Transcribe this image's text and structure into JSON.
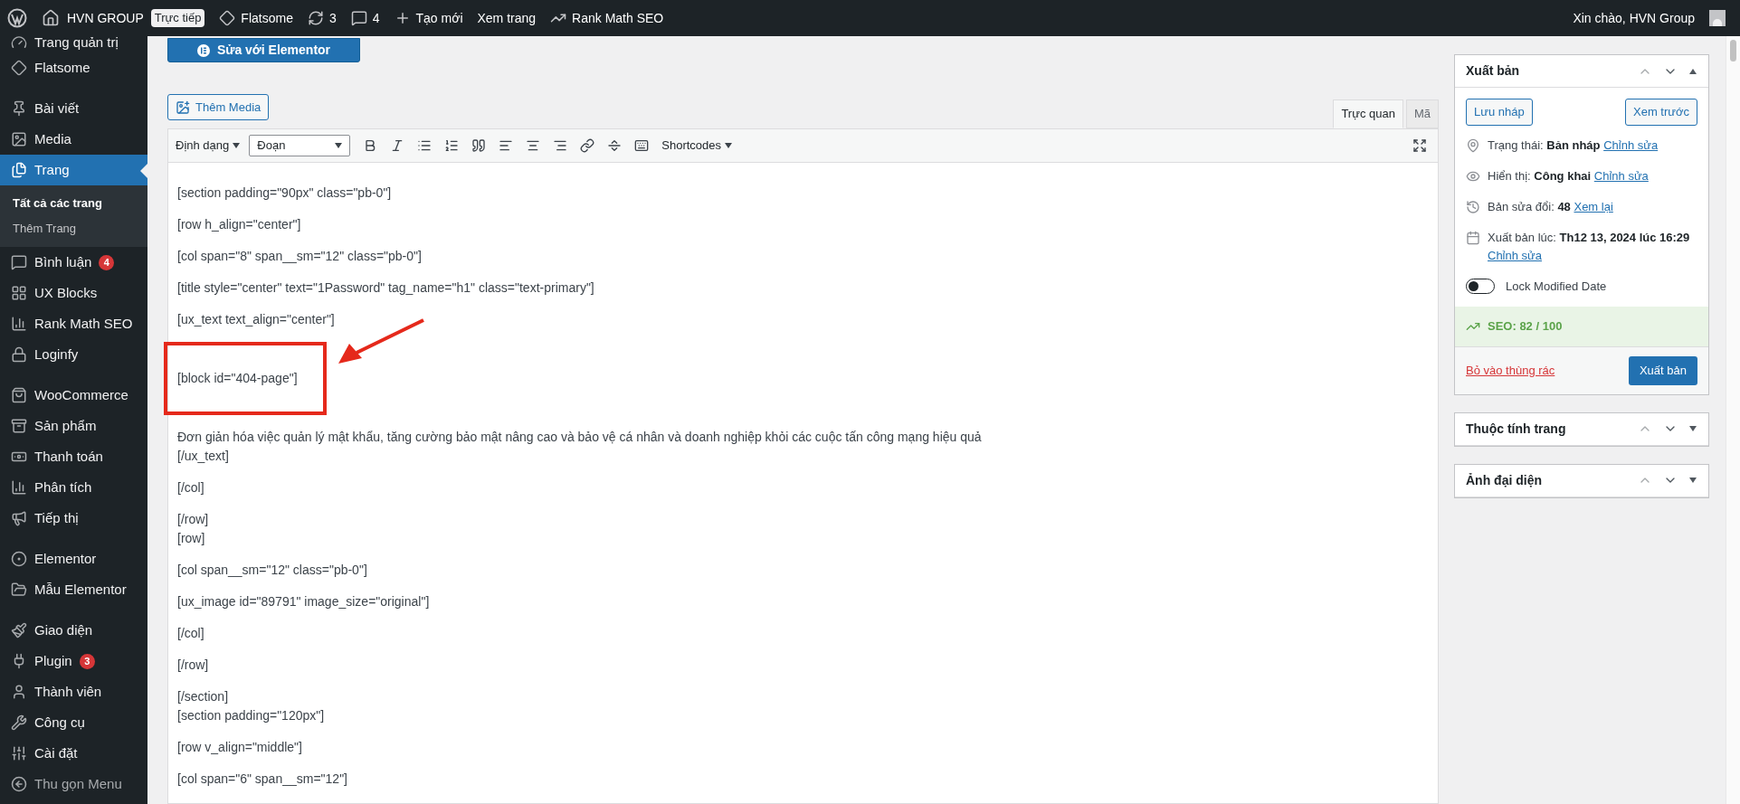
{
  "admin_bar": {
    "site": "HVN GROUP",
    "live_badge": "Trực tiếp",
    "items": [
      {
        "label": "Flatsome"
      },
      {
        "label": "3"
      },
      {
        "label": "4"
      },
      {
        "label": "Tạo mới"
      },
      {
        "label": "Xem trang"
      },
      {
        "label": "Rank Math SEO"
      }
    ],
    "greeting": "Xin chào, HVN Group"
  },
  "sidebar": {
    "groups": [
      {
        "items": [
          {
            "label": "Trang quản trị",
            "kind": "cut",
            "selected": false
          },
          {
            "label": "Flatsome",
            "selected": false
          }
        ]
      },
      {
        "items": [
          {
            "label": "Bài viết",
            "selected": false
          },
          {
            "label": "Media",
            "selected": false
          },
          {
            "label": "Trang",
            "selected": true,
            "children": [
              {
                "label": "Tất cả các trang",
                "selected": true
              },
              {
                "label": "Thêm Trang",
                "selected": false
              }
            ]
          },
          {
            "label": "Bình luận",
            "badge": "4",
            "selected": false
          },
          {
            "label": "UX Blocks",
            "selected": false
          },
          {
            "label": "Rank Math SEO",
            "selected": false
          },
          {
            "label": "Loginfy",
            "selected": false
          }
        ]
      },
      {
        "items": [
          {
            "label": "WooCommerce",
            "selected": false
          },
          {
            "label": "Sản phẩm",
            "selected": false
          },
          {
            "label": "Thanh toán",
            "selected": false
          },
          {
            "label": "Phân tích",
            "selected": false
          },
          {
            "label": "Tiếp thị",
            "selected": false
          }
        ]
      },
      {
        "items": [
          {
            "label": "Elementor",
            "selected": false
          },
          {
            "label": "Mẫu Elementor",
            "selected": false
          }
        ]
      },
      {
        "items": [
          {
            "label": "Giao diện",
            "selected": false
          },
          {
            "label": "Plugin",
            "badge": "3",
            "selected": false
          },
          {
            "label": "Thành viên",
            "selected": false
          },
          {
            "label": "Công cụ",
            "selected": false
          },
          {
            "label": "Cài đặt",
            "selected": false
          },
          {
            "label": "Thu gọn Menu",
            "kind": "collapse",
            "selected": false
          }
        ]
      }
    ]
  },
  "editor": {
    "elementor_button": "Sửa với Elementor",
    "media_button": "Thêm Media",
    "tabs": [
      {
        "label": "Trực quan",
        "selected": true
      },
      {
        "label": "Mã",
        "selected": false
      }
    ],
    "toolbar": {
      "format_menu": "Định dạng",
      "paragraph_select": "Đoạn",
      "shortcodes_menu": "Shortcodes"
    },
    "paragraphs": [
      {
        "lines": [
          "[section padding=\"90px\" class=\"pb-0\"]"
        ]
      },
      {
        "lines": [
          "[row h_align=\"center\"]"
        ]
      },
      {
        "lines": [
          "[col span=\"8\" span__sm=\"12\" class=\"pb-0\"]"
        ]
      },
      {
        "lines": [
          "[title style=\"center\" text=\"1Password\" tag_name=\"h1\" class=\"text-primary\"]"
        ]
      },
      {
        "lines": [
          "[ux_text text_align=\"center\"]"
        ]
      },
      {
        "lines": [
          "[block id=\"404-page\"]"
        ],
        "highlighted": true
      },
      {
        "lines": [
          "Đơn giản hóa việc quản lý mật khẩu, tăng cường bảo mật nâng cao và bảo vệ cá nhân và doanh nghiệp khỏi các cuộc tấn công mạng hiệu quả",
          "[/ux_text]"
        ]
      },
      {
        "lines": [
          "[/col]"
        ]
      },
      {
        "lines": [
          "[/row]",
          "[row]"
        ]
      },
      {
        "lines": [
          "[col span__sm=\"12\" class=\"pb-0\"]"
        ]
      },
      {
        "lines": [
          "[ux_image id=\"89791\" image_size=\"original\"]"
        ]
      },
      {
        "lines": [
          "[/col]"
        ]
      },
      {
        "lines": [
          "[/row]"
        ]
      },
      {
        "lines": [
          "[/section]",
          "[section padding=\"120px\"]"
        ]
      },
      {
        "lines": [
          "[row v_align=\"middle\"]"
        ]
      },
      {
        "lines": [
          "[col span=\"6\" span__sm=\"12\"]"
        ]
      }
    ]
  },
  "publish_box": {
    "title": "Xuất bản",
    "expanded": true,
    "save_draft": "Lưu nháp",
    "preview": "Xem trước",
    "rows": [
      {
        "label": "Trạng thái:",
        "value": "Bản nháp",
        "link": "Chỉnh sửa"
      },
      {
        "label": "Hiển thị:",
        "value": "Công khai",
        "link": "Chỉnh sửa"
      },
      {
        "label": "Bản sửa đổi:",
        "value": "48",
        "link": "Xem lại"
      },
      {
        "label": "Xuất bản lúc:",
        "value": "Th12 13, 2024 lúc 16:29",
        "link": "Chỉnh sửa"
      }
    ],
    "lock_toggle": {
      "label": "Lock Modified Date",
      "on": false
    },
    "seo": "SEO: 82 / 100",
    "trash": "Bỏ vào thùng rác",
    "publish": "Xuất bản"
  },
  "other_boxes": [
    {
      "title": "Thuộc tính trang",
      "expanded": false
    },
    {
      "title": "Ảnh đại diện",
      "expanded": false
    }
  ]
}
